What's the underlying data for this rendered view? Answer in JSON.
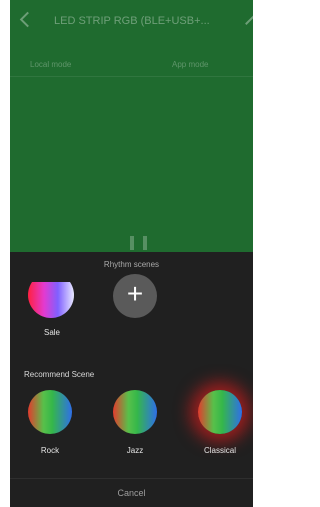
{
  "header": {
    "title": "LED STRIP RGB (BLE+USB+..."
  },
  "modes": {
    "local": "Local mode",
    "app": "App mode"
  },
  "sheet": {
    "title": "Rhythm scenes",
    "custom": {
      "label": "Sale",
      "add_symbol": "+"
    },
    "recommend_title": "Recommend Scene",
    "scenes": [
      {
        "label": "Rock"
      },
      {
        "label": "Jazz"
      },
      {
        "label": "Classical",
        "selected": true
      }
    ],
    "cancel": "Cancel"
  },
  "colors": {
    "background_green": "#1f6b2f",
    "sheet": "#202020",
    "selected_glow": "#ff1e1e"
  }
}
